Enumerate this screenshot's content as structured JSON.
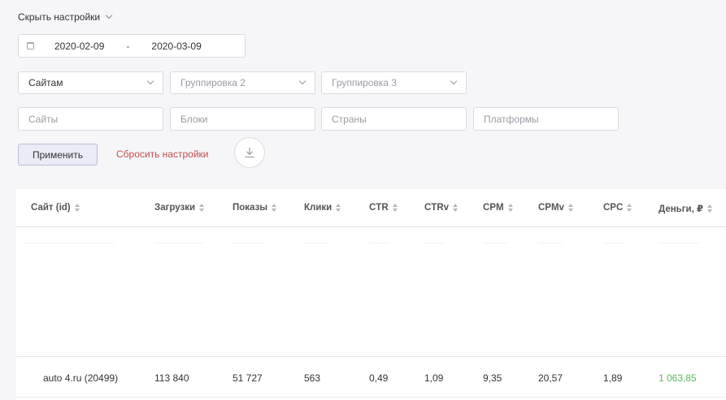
{
  "settings_toggle": {
    "label": "Скрыть настройки"
  },
  "date_range": {
    "from": "2020-02-09",
    "separator": "-",
    "to": "2020-03-09"
  },
  "groupings": [
    {
      "value": "Сайтам",
      "placeholder": false
    },
    {
      "value": "Группировка 2",
      "placeholder": true
    },
    {
      "value": "Группировка 3",
      "placeholder": true
    }
  ],
  "filters": {
    "sites_placeholder": "Сайты",
    "blocks_placeholder": "Блоки",
    "countries_placeholder": "Страны",
    "platforms_placeholder": "Платформы"
  },
  "actions": {
    "apply_label": "Применить",
    "reset_label": "Сбросить настройки"
  },
  "table": {
    "columns": [
      "Сайт (id)",
      "Загрузки",
      "Показы",
      "Клики",
      "CTR",
      "CTRv",
      "CPM",
      "CPMv",
      "CPC",
      "Деньги, ₽"
    ],
    "rows": [
      {
        "site": "auto  4.ru (20499)",
        "loads": "113 840",
        "impressions": "51 727",
        "clicks": "563",
        "ctr": "0,49",
        "ctrv": "1,09",
        "cpm": "9,35",
        "cpmv": "20,57",
        "cpc": "1,89",
        "money": "1 063,85"
      }
    ]
  },
  "colors": {
    "money": "#5cb85c",
    "reset": "#c0504d",
    "apply_bg": "#e9ebf6"
  },
  "icons": {
    "toggle": "chevron-down-icon",
    "date": "calendar-icon",
    "download": "download-icon",
    "sort": "sort-icon"
  }
}
